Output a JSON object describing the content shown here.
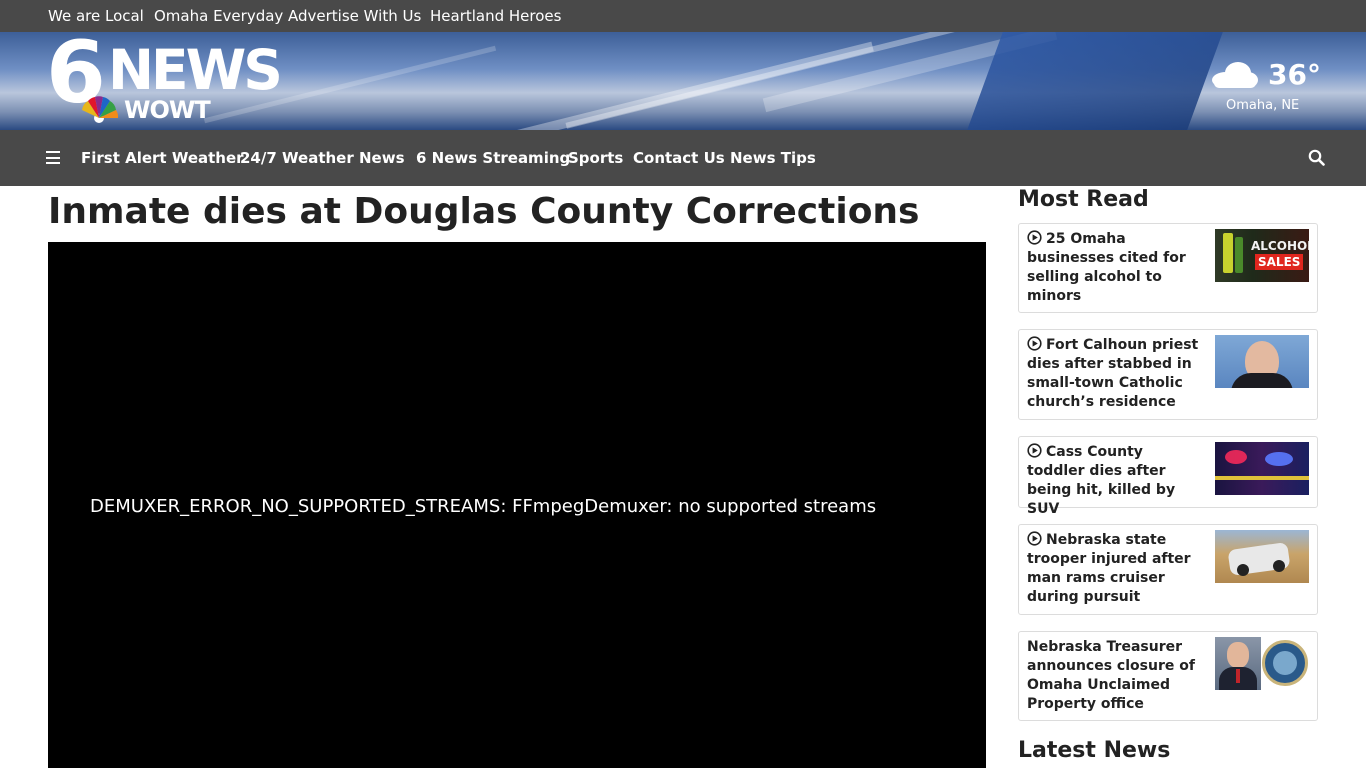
{
  "top_links": [
    "We are Local",
    "Omaha Everyday",
    "Advertise With Us",
    "Heartland Heroes"
  ],
  "logo": {
    "six": "6",
    "news": "NEWS",
    "call_sign": "WOWT"
  },
  "weather": {
    "temp": "36°",
    "location": "Omaha, NE",
    "icon": "cloudy-icon"
  },
  "nav": {
    "items": [
      "First Alert Weather",
      "24/7 Weather",
      "News",
      "6 News Streaming",
      "Sports",
      "Contact Us",
      "News Tips"
    ]
  },
  "article": {
    "title": "Inmate dies at Douglas County Corrections"
  },
  "video": {
    "error": "DEMUXER_ERROR_NO_SUPPORTED_STREAMS: FFmpegDemuxer: no supported streams"
  },
  "sidebar": {
    "most_read_title": "Most Read",
    "latest_title": "Latest News",
    "items": [
      {
        "text": "25 Omaha businesses cited for selling alcohol to minors",
        "video": true,
        "thumb_text": "ALCOHOL SALES"
      },
      {
        "text": "Fort Calhoun priest dies after stabbed in small-town Catholic church’s residence",
        "video": true
      },
      {
        "text": "Cass County toddler dies after being hit, killed by SUV",
        "video": true
      },
      {
        "text": "Nebraska state trooper injured after man rams cruiser during pursuit",
        "video": true
      },
      {
        "text": "Nebraska Treasurer announces closure of Omaha Unclaimed Property office",
        "video": false
      }
    ]
  },
  "colors": {
    "bar": "#494949",
    "banner": "#5a7ab0"
  }
}
